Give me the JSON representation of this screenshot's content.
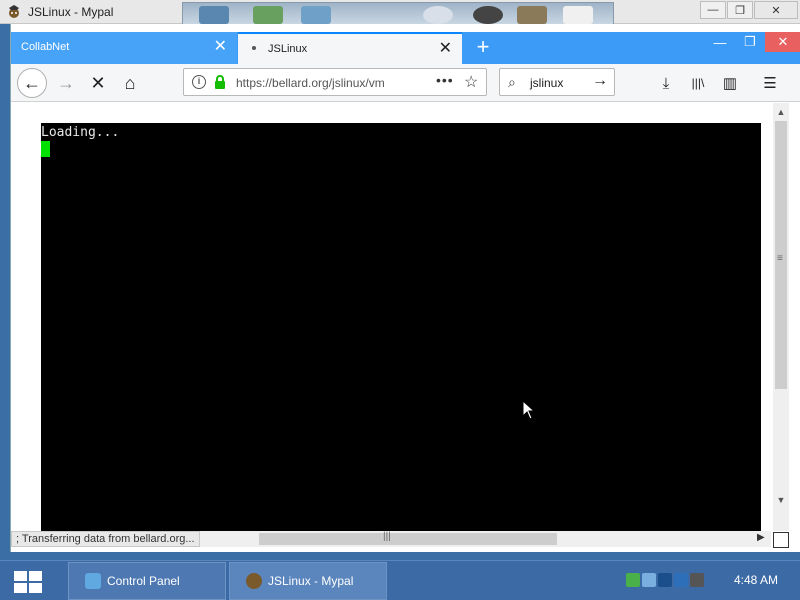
{
  "outer_window": {
    "title": "JSLinux - Mypal",
    "controls": [
      "—",
      "❐",
      "✕"
    ]
  },
  "tabs": [
    {
      "label": "CollabNet",
      "active": false,
      "close": "✕"
    },
    {
      "label": "JSLinux",
      "active": true,
      "close": "✕"
    }
  ],
  "new_tab_label": "+",
  "browser_window_controls": [
    "—",
    "❐",
    "✕"
  ],
  "navbar": {
    "back": "←",
    "forward": "→",
    "stop": "✕",
    "home": "⌂",
    "url": "https://bellard.org/jslinux/vm",
    "page_actions": "•••",
    "bookmark": "☆",
    "search_query": "jslinux",
    "search_go": "→",
    "download": "⤓",
    "library": "|||\\",
    "sidebar": "▥",
    "menu": "☰"
  },
  "terminal": {
    "text": "Loading...",
    "cursor_color": "#00e000"
  },
  "status_text": "; Transferring data from bellard.org...",
  "scrollbars": {
    "v_grip": "≡",
    "h_grip": "|||",
    "up": "▲",
    "down": "▼",
    "right": "▶"
  },
  "taskbar": {
    "items": [
      {
        "label": "Control Panel"
      },
      {
        "label": "JSLinux - Mypal"
      }
    ],
    "clock": "4:48 AM"
  },
  "colors": {
    "tab_bar": "#3b9bf6",
    "taskbar": "#3c6aa5",
    "terminal_bg": "#000000"
  }
}
